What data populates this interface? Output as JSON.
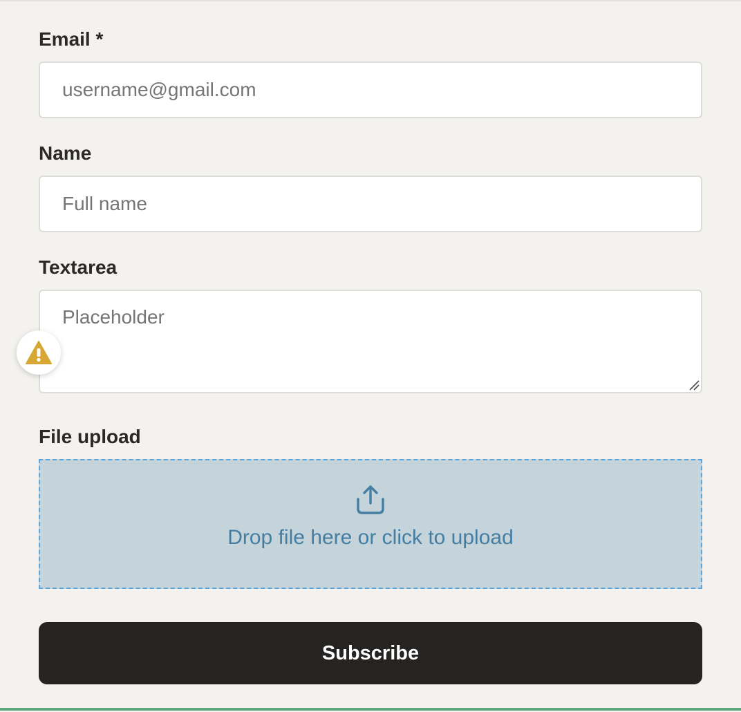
{
  "form": {
    "email": {
      "label": "Email *",
      "value": "",
      "placeholder": "username@gmail.com"
    },
    "name": {
      "label": "Name",
      "value": "",
      "placeholder": "Full name"
    },
    "textarea": {
      "label": "Textarea",
      "value": "",
      "placeholder": "Placeholder"
    },
    "file_upload": {
      "label": "File upload",
      "dropzone_text": "Drop file here or click to upload",
      "icon": "upload-icon"
    },
    "submit_label": "Subscribe",
    "warning_icon": "warning-icon"
  },
  "colors": {
    "background": "#f3f2ee",
    "button": "#252422",
    "dropzone_bg": "#c5d3da",
    "dropzone_border": "#5aa6dc",
    "dropzone_text": "#457ea2",
    "warning": "#d6a733",
    "bottom_accent": "#5aa87c"
  }
}
